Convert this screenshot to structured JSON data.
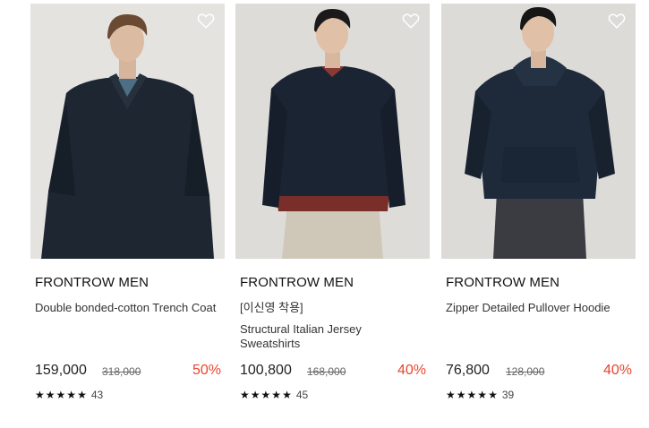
{
  "products": [
    {
      "brand": "FRONTROW MEN",
      "tag": "",
      "name": "Double bonded-cotton Trench Coat",
      "price": "159,000",
      "original_price": "318,000",
      "discount": "50%",
      "rating_count": "43",
      "rating": 5,
      "photo_icon": "model-in-navy-trench-coat"
    },
    {
      "brand": "FRONTROW MEN",
      "tag": "[이신영 착용]",
      "name": "Structural Italian Jersey Sweatshirts",
      "price": "100,800",
      "original_price": "168,000",
      "discount": "40%",
      "rating_count": "45",
      "rating": 5,
      "photo_icon": "model-in-navy-sweatshirt"
    },
    {
      "brand": "FRONTROW MEN",
      "tag": "",
      "name": "Zipper Detailed Pullover Hoodie",
      "price": "76,800",
      "original_price": "128,000",
      "discount": "40%",
      "rating_count": "39",
      "rating": 5,
      "photo_icon": "model-in-navy-hoodie"
    }
  ],
  "colors": {
    "discount": "#e8452f",
    "text": "#222222",
    "strike": "#666666",
    "garment": "#1e2a38"
  },
  "icons": {
    "wishlist": "heart-outline-icon",
    "star": "star-icon"
  }
}
